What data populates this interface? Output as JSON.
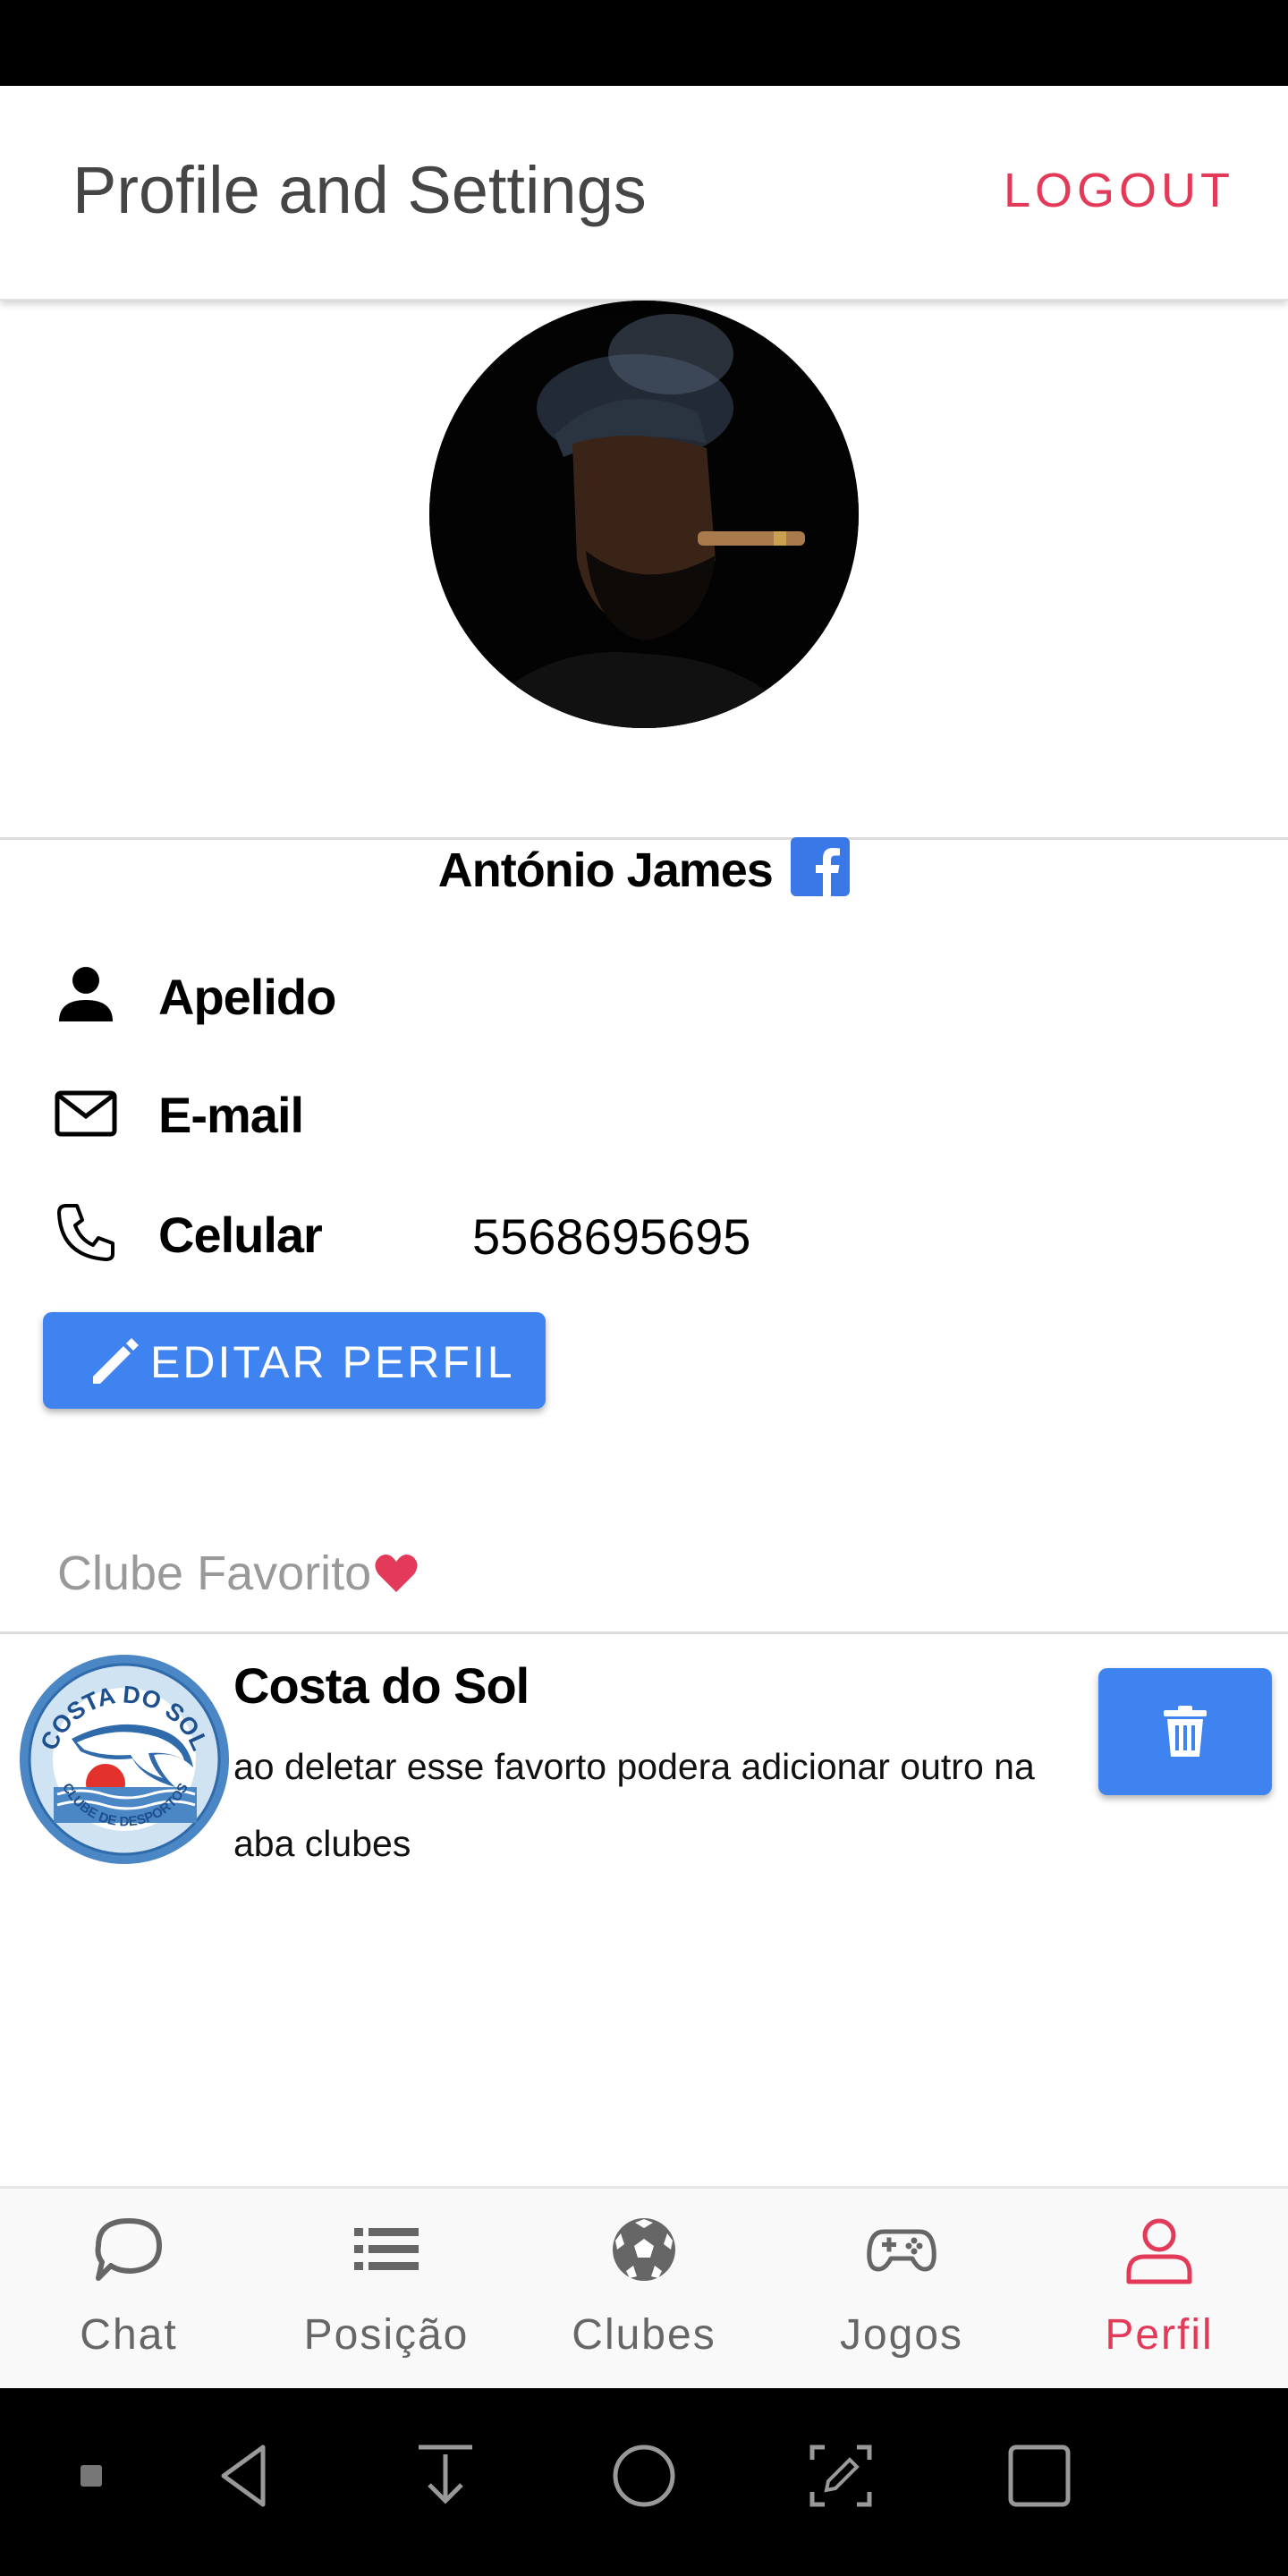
{
  "header": {
    "title": "Profile and Settings",
    "logout_label": "LOGOUT"
  },
  "profile": {
    "name": "António James",
    "fields": [
      {
        "icon": "person-icon",
        "label": "Apelido",
        "value": ""
      },
      {
        "icon": "mail-icon",
        "label": "E-mail",
        "value": ""
      },
      {
        "icon": "phone-icon",
        "label": "Celular",
        "value": "5568695695"
      }
    ],
    "edit_label": "EDITAR PERFIL"
  },
  "favorite": {
    "section_title": "Clube Favorito",
    "club_name": "Costa do Sol",
    "club_desc": "ao deletar esse favorto podera adicionar outro na aba clubes",
    "logo_text_top": "COSTA DO SOL",
    "logo_text_bottom": "CLUBE DE DESPORTOS"
  },
  "nav": {
    "items": [
      {
        "label": "Chat",
        "icon": "chat-icon"
      },
      {
        "label": "Posição",
        "icon": "list-icon"
      },
      {
        "label": "Clubes",
        "icon": "soccer-ball-icon"
      },
      {
        "label": "Jogos",
        "icon": "gamepad-icon"
      },
      {
        "label": "Perfil",
        "icon": "person-outline-icon"
      }
    ],
    "active": "Perfil"
  },
  "colors": {
    "accent": "#e33a59",
    "primary": "#3f83f0",
    "facebook": "#3b78e7"
  }
}
